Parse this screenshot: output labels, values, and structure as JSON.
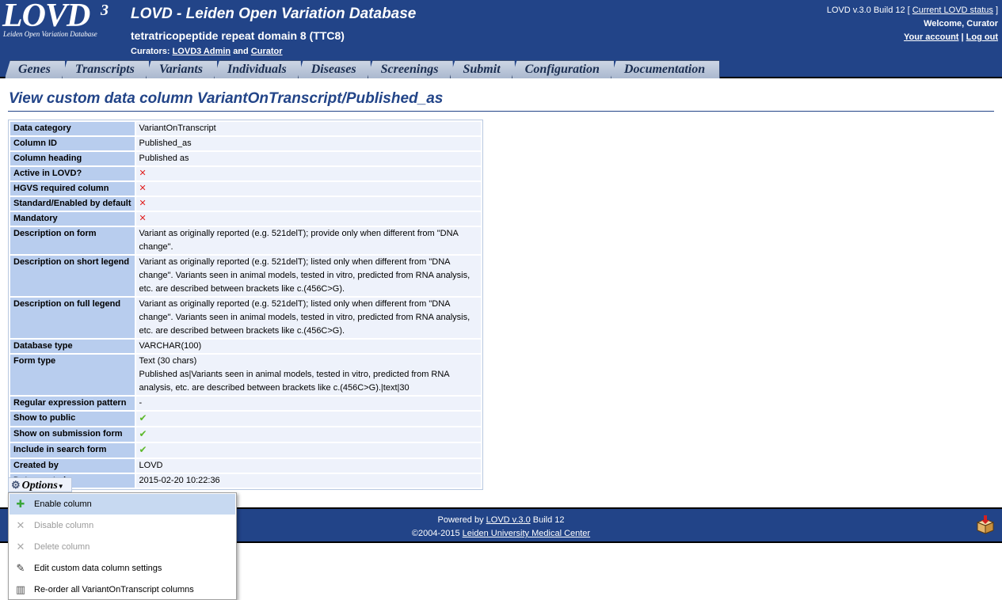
{
  "header": {
    "logo_text": "LOVD",
    "logo_sup": "3",
    "logo_subtitle": "Leiden Open Variation Database",
    "app_title": "LOVD - Leiden Open Variation Database",
    "gene_title": "tetratricopeptide repeat domain 8 (TTC8)",
    "curators_prefix": "Curators:",
    "curator1": "LOVD3 Admin",
    "curators_and": "and",
    "curator2": "Curator",
    "version_text": "LOVD v.3.0 Build 12 [",
    "status_link": "Current LOVD status",
    "version_close": "]",
    "welcome": "Welcome, Curator",
    "account_link": "Your account",
    "separator": "|",
    "logout_link": "Log out"
  },
  "tabs": [
    "Genes",
    "Transcripts",
    "Variants",
    "Individuals",
    "Diseases",
    "Screenings",
    "Submit",
    "Configuration",
    "Documentation"
  ],
  "page_title": "View custom data column VariantOnTranscript/Published_as",
  "rows": [
    {
      "label": "Data category",
      "value": "VariantOnTranscript"
    },
    {
      "label": "Column ID",
      "value": "Published_as"
    },
    {
      "label": "Column heading",
      "value": "Published as"
    },
    {
      "label": "Active in LOVD?",
      "value": "✕"
    },
    {
      "label": "HGVS required column",
      "value": "✕"
    },
    {
      "label": "Standard/Enabled by default",
      "value": "✕"
    },
    {
      "label": "Mandatory",
      "value": "✕"
    },
    {
      "label": "Description on form",
      "value": "Variant as originally reported (e.g. 521delT); provide only when different from \"DNA change\"."
    },
    {
      "label": "Description on short legend",
      "value": "Variant as originally reported (e.g. 521delT); listed only when different from \"DNA change\". Variants seen in animal models, tested in vitro, predicted from RNA analysis, etc. are described between brackets like c.(456C>G)."
    },
    {
      "label": "Description on full legend",
      "value": "Variant as originally reported (e.g. 521delT); listed only when different from \"DNA change\". Variants seen in animal models, tested in vitro, predicted from RNA analysis, etc. are described between brackets like c.(456C>G)."
    },
    {
      "label": "Database type",
      "value": "VARCHAR(100)"
    },
    {
      "label": "Form type",
      "value": "Text (30 chars)",
      "value2": "Published as|Variants seen in animal models, tested in vitro, predicted from RNA analysis, etc. are described between brackets like c.(456C>G).|text|30"
    },
    {
      "label": "Regular expression pattern",
      "value": "-"
    },
    {
      "label": "Show to public",
      "value": "✔"
    },
    {
      "label": "Show on submission form",
      "value": "✔"
    },
    {
      "label": "Include in search form",
      "value": "✔"
    },
    {
      "label": "Created by",
      "value": "LOVD"
    },
    {
      "label": "Date created",
      "value": "2015-02-20 10:22:36"
    }
  ],
  "options": {
    "label": "Options",
    "menu": [
      {
        "label": "Enable column",
        "icon": "✚",
        "icon_name": "plus-icon",
        "enabled": true,
        "highlight": true
      },
      {
        "label": "Disable column",
        "icon": "✕",
        "icon_name": "cross-icon",
        "enabled": false
      },
      {
        "label": "Delete column",
        "icon": "✕",
        "icon_name": "cross-icon",
        "enabled": false
      },
      {
        "label": "Edit custom data column settings",
        "icon": "✎",
        "icon_name": "pencil-icon",
        "enabled": true
      },
      {
        "label": "Re-order all VariantOnTranscript columns",
        "icon": "▥",
        "icon_name": "columns-icon",
        "enabled": true
      }
    ]
  },
  "footer": {
    "powered_prefix": "Powered by",
    "powered_link": "LOVD v.3.0",
    "powered_suffix": "Build 12",
    "copyright_prefix": "©2004-2015",
    "copyright_link": "Leiden University Medical Center"
  },
  "colors": {
    "header_bg": "#224488",
    "title_blue": "#224488",
    "label_bg": "#b8cdee",
    "value_bg": "#eef2fb",
    "cross_red": "#e02020",
    "check_green": "#5cb82a"
  }
}
